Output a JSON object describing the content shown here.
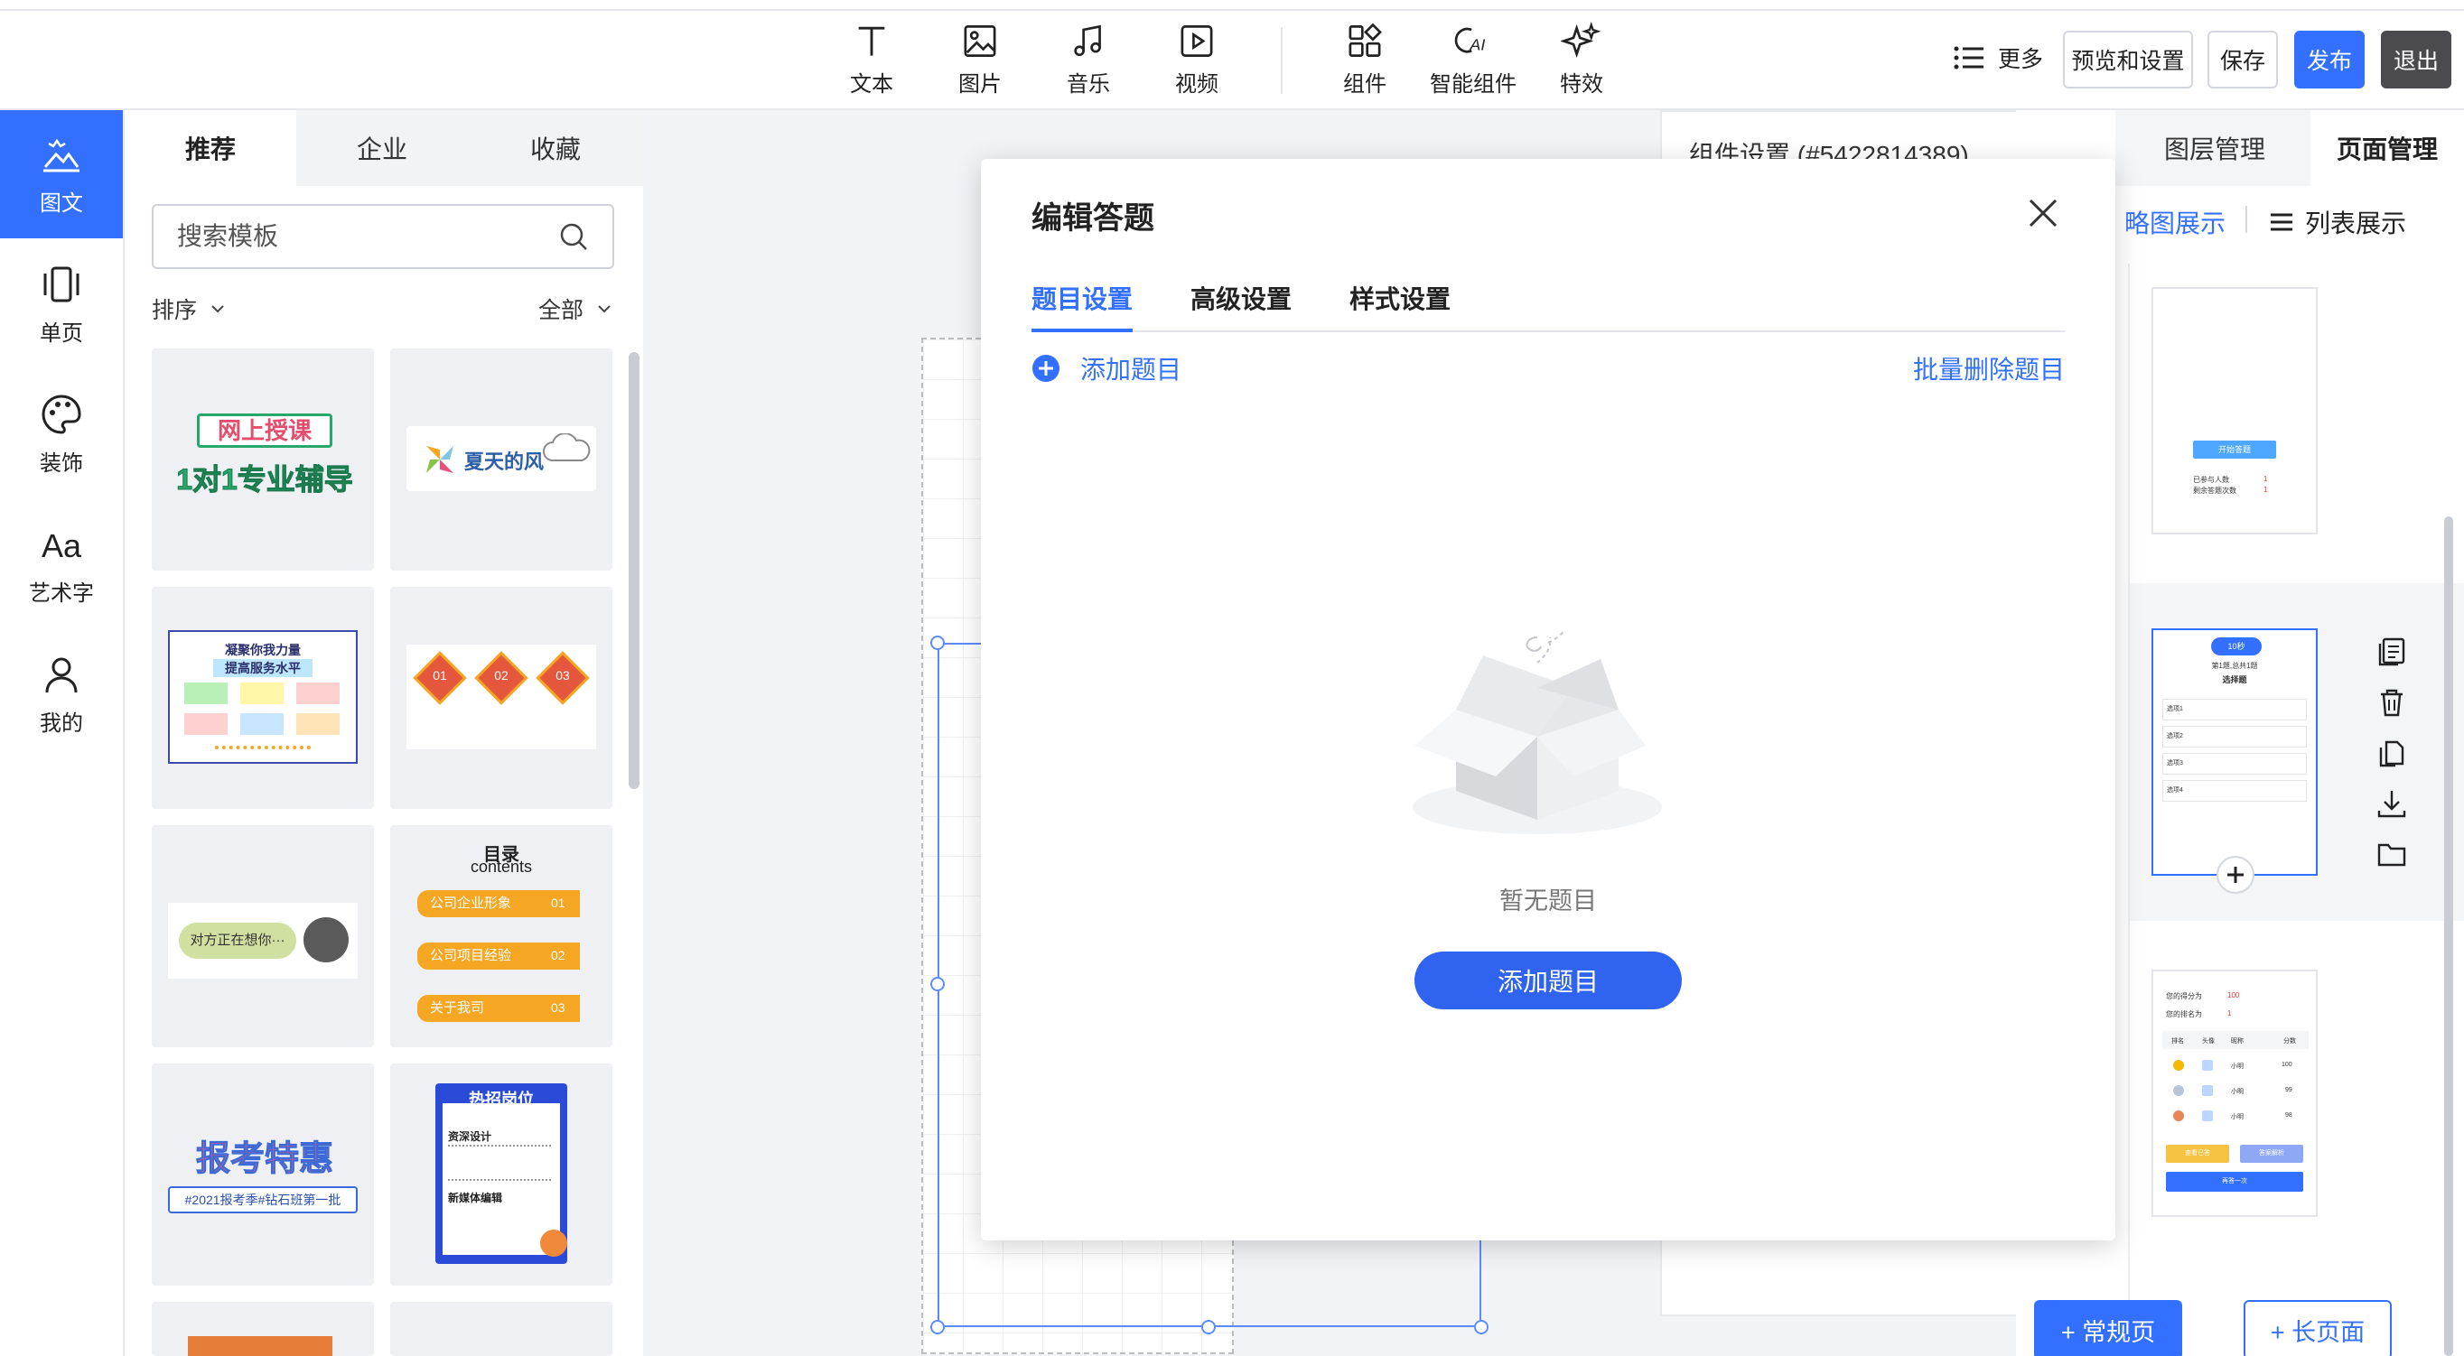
{
  "toolbar": {
    "tools": [
      {
        "label": "文本",
        "icon": "text-icon"
      },
      {
        "label": "图片",
        "icon": "image-icon"
      },
      {
        "label": "音乐",
        "icon": "music-icon"
      },
      {
        "label": "视频",
        "icon": "video-icon"
      },
      {
        "label": "组件",
        "icon": "components-icon"
      },
      {
        "label": "智能组件",
        "icon": "ai-components-icon"
      },
      {
        "label": "特效",
        "icon": "sparkle-icon"
      }
    ],
    "more_label": "更多",
    "preview_label": "预览和设置",
    "save_label": "保存",
    "publish_label": "发布",
    "exit_label": "退出",
    "accent": "#3370ff"
  },
  "leftnav": {
    "items": [
      {
        "label": "图文",
        "icon": "image-text-icon",
        "active": true
      },
      {
        "label": "单页",
        "icon": "single-page-icon"
      },
      {
        "label": "装饰",
        "icon": "palette-icon"
      },
      {
        "label": "艺术字",
        "icon": "art-text-icon"
      },
      {
        "label": "我的",
        "icon": "user-icon"
      }
    ]
  },
  "templates": {
    "tabs": [
      "推荐",
      "企业",
      "收藏"
    ],
    "active_tab": "推荐",
    "search_placeholder": "搜索模板",
    "sort_label": "排序",
    "filter_label": "全部",
    "cards": [
      {
        "line1": "网上授课",
        "line2": "1对1专业辅导"
      },
      {
        "text": "夏天的风"
      },
      {
        "title1": "凝聚你我力量",
        "title2": "提高服务水平"
      },
      {
        "n1": "01",
        "n2": "02",
        "n3": "03"
      },
      {
        "text": "对方正在想你···"
      },
      {
        "title": "目录",
        "subtitle": "contents",
        "items": [
          "公司企业形象",
          "公司项目经验",
          "关于我司"
        ],
        "nums": [
          "01",
          "02",
          "03"
        ]
      },
      {
        "line1": "报考特惠",
        "line2": "#2021报考季#钻石班第一批"
      },
      {
        "title": "热招岗位",
        "sub1": "资深设计",
        "sub2": "新媒体编辑"
      }
    ]
  },
  "component_settings": {
    "title": "组件设置 (#5422814389)"
  },
  "modal": {
    "title": "编辑答题",
    "tabs": [
      "题目设置",
      "高级设置",
      "样式设置"
    ],
    "active_tab": "题目设置",
    "add_question_link": "添加题目",
    "batch_delete_link": "批量删除题目",
    "empty_text": "暂无题目",
    "add_button": "添加题目"
  },
  "right_panel": {
    "tabs": [
      "图层管理",
      "页面管理"
    ],
    "active_tab": "页面管理",
    "view_thumb": "略图展示",
    "view_list": "列表展示",
    "add_normal_page": "+ 常规页",
    "add_long_page": "+ 长页面",
    "thumb1": {
      "button": "开始答题",
      "line1": "已参与人数",
      "line2": "剩余答题次数",
      "val": "1"
    },
    "thumb2": {
      "timer": "10秒",
      "header": "第1题,总共1题",
      "qtype": "选择题",
      "options": [
        "选项1",
        "选项2",
        "选项3",
        "选项4"
      ]
    },
    "thumb3": {
      "score_label": "您的得分为",
      "score": "100",
      "rank_label": "您的排名为",
      "rank": "1",
      "cols": [
        "排名",
        "头像",
        "昵称",
        "分数"
      ],
      "rows": [
        {
          "name": "小明",
          "score": "100"
        },
        {
          "name": "小明",
          "score": "99"
        },
        {
          "name": "小明",
          "score": "98"
        }
      ],
      "btn_share": "查看已答",
      "btn_analysis": "答案解析",
      "btn_retry": "再答一次"
    }
  }
}
